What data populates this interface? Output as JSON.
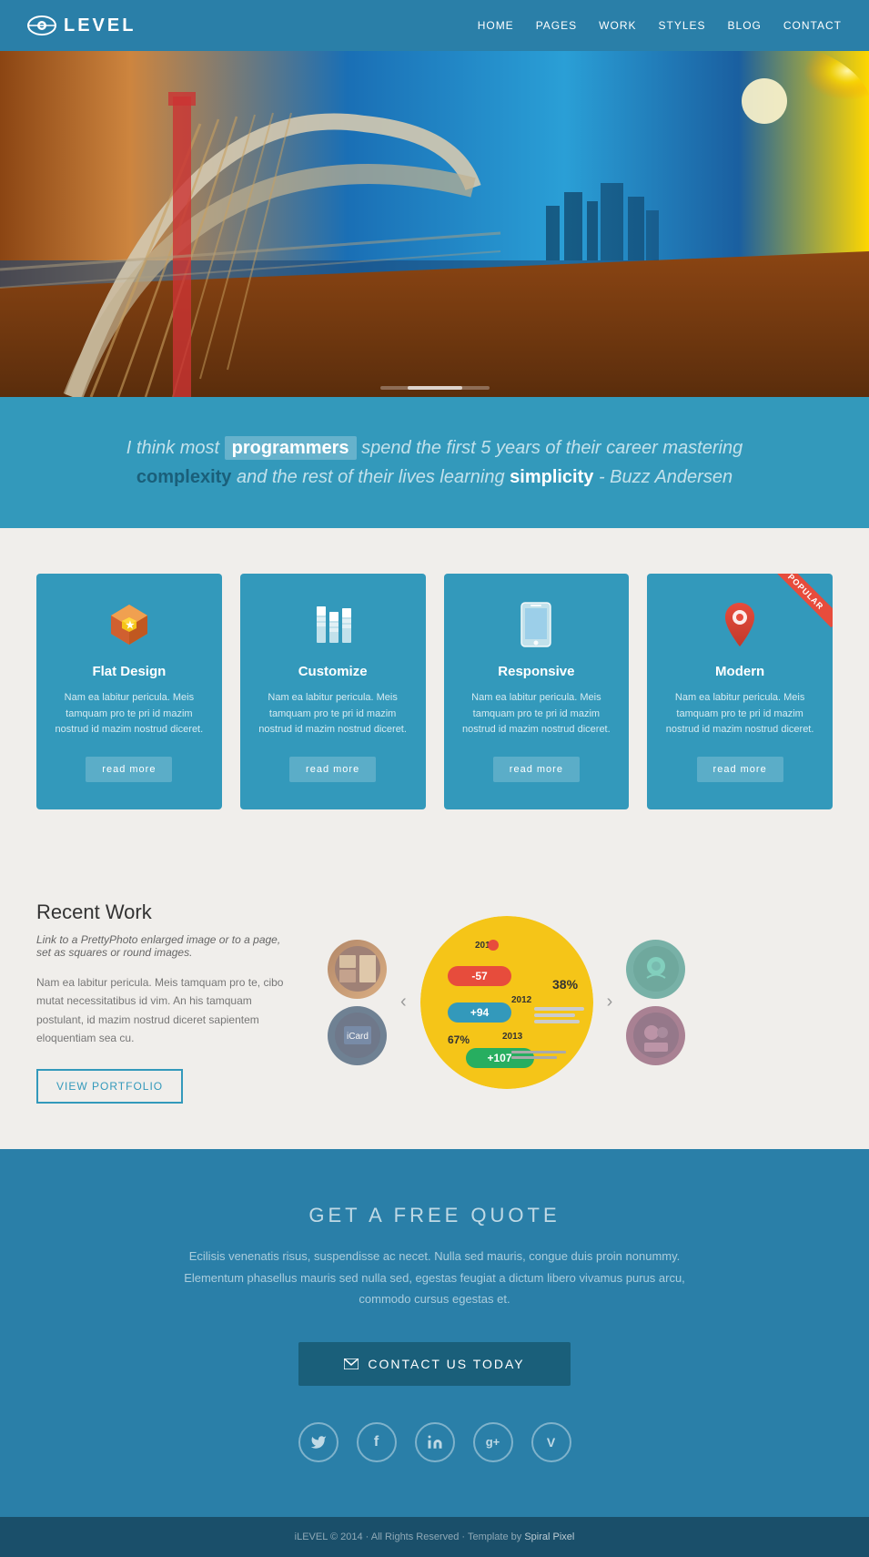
{
  "header": {
    "logo_text": "LEVEL",
    "nav_items": [
      "HOME",
      "PAGES",
      "WORK",
      "STYLES",
      "BLOG",
      "CONTACT"
    ]
  },
  "quote": {
    "text_before": "I think most ",
    "highlight": "programmers",
    "text_middle": " spend the first 5 years of their career mastering",
    "bold_complexity": "complexity",
    "text_after_complexity": "and the rest of their lives learning ",
    "bold_simplicity": "simplicity",
    "author": " - Buzz Andersen"
  },
  "features": {
    "cards": [
      {
        "title": "Flat Design",
        "desc": "Nam ea labitur pericula. Meis tamquam pro te pri id mazim nostrud id mazim nostrud diceret.",
        "read_more": "read more",
        "popular": false,
        "icon": "shield"
      },
      {
        "title": "Customize",
        "desc": "Nam ea labitur pericula. Meis tamquam pro te pri id mazim nostrud id mazim nostrud diceret.",
        "read_more": "read more",
        "popular": false,
        "icon": "database"
      },
      {
        "title": "Responsive",
        "desc": "Nam ea labitur pericula. Meis tamquam pro te pri id mazim nostrud id mazim nostrud diceret.",
        "read_more": "read more",
        "popular": false,
        "icon": "phone"
      },
      {
        "title": "Modern",
        "desc": "Nam ea labitur pericula. Meis tamquam pro te pri id mazim nostrud id mazim nostrud diceret.",
        "read_more": "read more",
        "popular": true,
        "icon": "location"
      }
    ]
  },
  "recent_work": {
    "title": "Recent Work",
    "subtitle": "Link to a PrettyPhoto enlarged image or to a page, set as squares or round images.",
    "desc": "Nam ea labitur pericula. Meis tamquam pro te, cibo mutat necessitatibus id vim. An his tamquam postulant, id mazim nostrud diceret sapientem eloquentiam sea cu.",
    "view_portfolio_label": "VIEW PORTFOLIO"
  },
  "free_quote": {
    "title": "GET A FREE QUOTE",
    "desc": "Ecilisis venenatis risus, suspendisse ac necet. Nulla sed mauris, congue duis proin nonummy. Elementum phasellus mauris sed nulla sed, egestas feugiat a dictum libero vivamus purus arcu, commodo cursus egestas et.",
    "contact_label": "CONTACT US TODAY"
  },
  "social": {
    "items": [
      {
        "name": "twitter",
        "symbol": "🐦"
      },
      {
        "name": "facebook",
        "symbol": "f"
      },
      {
        "name": "linkedin",
        "symbol": "in"
      },
      {
        "name": "google-plus",
        "symbol": "g+"
      },
      {
        "name": "vimeo",
        "symbol": "V"
      }
    ]
  },
  "footer": {
    "text": "iLEVEL © 2014 · All Rights Reserved · Template by ",
    "author": "Spiral Pixel"
  }
}
